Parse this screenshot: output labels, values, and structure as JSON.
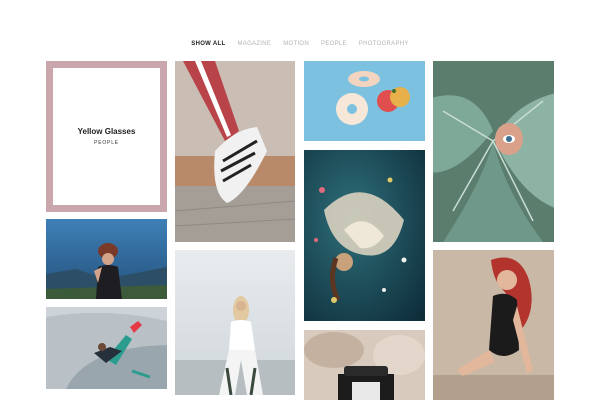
{
  "filter": {
    "tabs": [
      {
        "label": "SHOW ALL",
        "active": true
      },
      {
        "label": "MAGAZINE",
        "active": false
      },
      {
        "label": "MOTION",
        "active": false
      },
      {
        "label": "PEOPLE",
        "active": false
      },
      {
        "label": "PHOTOGRAPHY",
        "active": false
      }
    ]
  },
  "featured": {
    "title": "Yellow Glasses",
    "category": "PEOPLE"
  },
  "colors": {
    "accent_frame": "#c9a7ad",
    "active_tab": "#222222",
    "inactive_tab": "#b3b3b3"
  }
}
